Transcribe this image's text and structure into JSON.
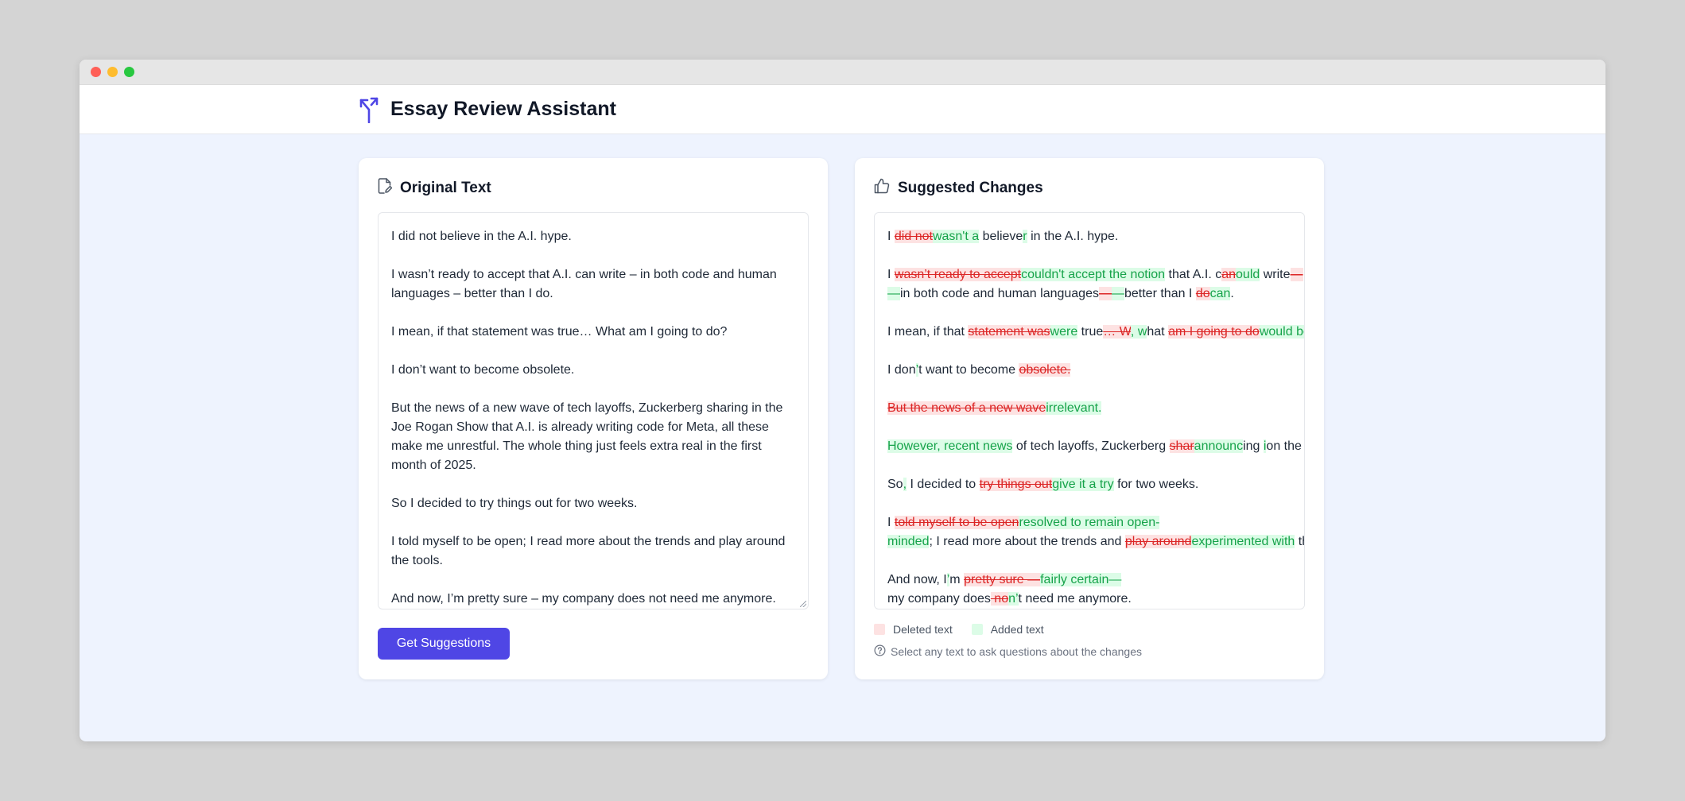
{
  "window": {
    "title": "Essay Review Assistant"
  },
  "original": {
    "title": "Original Text",
    "paragraphs": [
      "I did not believe in the A.I. hype.",
      "I wasn’t ready to accept that A.I. can write – in both code and human languages – better than I do.",
      "I mean, if that statement was true… What am I going to do?",
      "I don’t want to become obsolete.",
      "But the news of a new wave of tech layoffs, Zuckerberg sharing in the Joe Rogan Show that A.I. is already writing code for Meta, all these make me unrestful. The whole thing just feels extra real in the first month of 2025.",
      "So I decided to try things out for two weeks.",
      "I told myself to be open; I read more about the trends and play around the tools.",
      "And now, I’m pretty sure – my company does not need me anymore."
    ],
    "button_label": "Get Suggestions"
  },
  "suggested": {
    "title": "Suggested Changes",
    "paragraphs": [
      [
        {
          "t": "I ",
          "k": "plain"
        },
        {
          "t": "did not",
          "k": "del"
        },
        {
          "t": "wasn't a",
          "k": "add"
        },
        {
          "t": " believe",
          "k": "plain"
        },
        {
          "t": "r",
          "k": "add"
        },
        {
          "t": " in the A.I. hype.",
          "k": "plain"
        }
      ],
      [
        {
          "t": "I ",
          "k": "plain"
        },
        {
          "t": "wasn’t ready to accept",
          "k": "del"
        },
        {
          "t": "couldn't accept the notion",
          "k": "add"
        },
        {
          "t": " that A.I. c",
          "k": "plain"
        },
        {
          "t": "an",
          "k": "del"
        },
        {
          "t": "ould",
          "k": "add"
        },
        {
          "t": " write",
          "k": "plain"
        },
        {
          "t": "—",
          "k": "del"
        },
        {
          "t": "BR",
          "k": "br"
        },
        {
          "t": "—",
          "k": "add"
        },
        {
          "t": "in both code and human languages",
          "k": "plain"
        },
        {
          "t": "—",
          "k": "del"
        },
        {
          "t": "—",
          "k": "add"
        },
        {
          "t": "better than I ",
          "k": "plain"
        },
        {
          "t": "do",
          "k": "del"
        },
        {
          "t": "can",
          "k": "add"
        },
        {
          "t": ".",
          "k": "plain"
        }
      ],
      [
        {
          "t": "I mean, if that ",
          "k": "plain"
        },
        {
          "t": "statement was",
          "k": "del"
        },
        {
          "t": "were",
          "k": "add"
        },
        {
          "t": " true",
          "k": "plain"
        },
        {
          "t": "… W",
          "k": "del"
        },
        {
          "t": ", w",
          "k": "add"
        },
        {
          "t": "hat ",
          "k": "plain"
        },
        {
          "t": "am I going to do",
          "k": "del"
        },
        {
          "t": "would be",
          "k": "add"
        }
      ],
      [
        {
          "t": "I don",
          "k": "plain"
        },
        {
          "t": "’",
          "k": "add"
        },
        {
          "t": "t want to become ",
          "k": "plain"
        },
        {
          "t": "obsolete.",
          "k": "del"
        }
      ],
      [
        {
          "t": "But the news of a new wave",
          "k": "del"
        },
        {
          "t": "irrelevant.",
          "k": "add"
        }
      ],
      [
        {
          "t": "However, recent news",
          "k": "add"
        },
        {
          "t": " of tech layoffs, Zuckerberg ",
          "k": "plain"
        },
        {
          "t": "shar",
          "k": "del"
        },
        {
          "t": "announc",
          "k": "add"
        },
        {
          "t": "ing ",
          "k": "plain"
        },
        {
          "t": "i",
          "k": "add"
        },
        {
          "t": "on the Joe Rogan",
          "k": "plain"
        }
      ],
      [
        {
          "t": "So",
          "k": "plain"
        },
        {
          "t": ",",
          "k": "add"
        },
        {
          "t": " I decided to ",
          "k": "plain"
        },
        {
          "t": "try things out",
          "k": "del"
        },
        {
          "t": "give it a try",
          "k": "add"
        },
        {
          "t": " for two weeks.",
          "k": "plain"
        }
      ],
      [
        {
          "t": "I ",
          "k": "plain"
        },
        {
          "t": "told myself to be open",
          "k": "del"
        },
        {
          "t": "resolved to remain open-",
          "k": "add"
        },
        {
          "t": "BR",
          "k": "br"
        },
        {
          "t": "minded",
          "k": "add"
        },
        {
          "t": "; I read more about the trends and ",
          "k": "plain"
        },
        {
          "t": "play around",
          "k": "del"
        },
        {
          "t": "experimented with",
          "k": "add"
        },
        {
          "t": " the tools.",
          "k": "plain"
        }
      ],
      [
        {
          "t": "And now, I",
          "k": "plain"
        },
        {
          "t": "’",
          "k": "add"
        },
        {
          "t": "m ",
          "k": "plain"
        },
        {
          "t": "pretty sure —",
          "k": "del"
        },
        {
          "t": "fairly certain—",
          "k": "add"
        },
        {
          "t": "BR",
          "k": "br"
        },
        {
          "t": "my company does",
          "k": "plain"
        },
        {
          "t": " no",
          "k": "del"
        },
        {
          "t": "n’",
          "k": "add"
        },
        {
          "t": "t need me anymore.",
          "k": "plain"
        }
      ]
    ],
    "legend": {
      "deleted_label": "Deleted text",
      "added_label": "Added text"
    },
    "hint": "Select any text to ask questions about the changes"
  },
  "colors": {
    "accent": "#4f46e5",
    "deleted_bg": "#fde2e2",
    "deleted_fg": "#dc2626",
    "added_bg": "#dcfce7",
    "added_fg": "#16a34a"
  }
}
